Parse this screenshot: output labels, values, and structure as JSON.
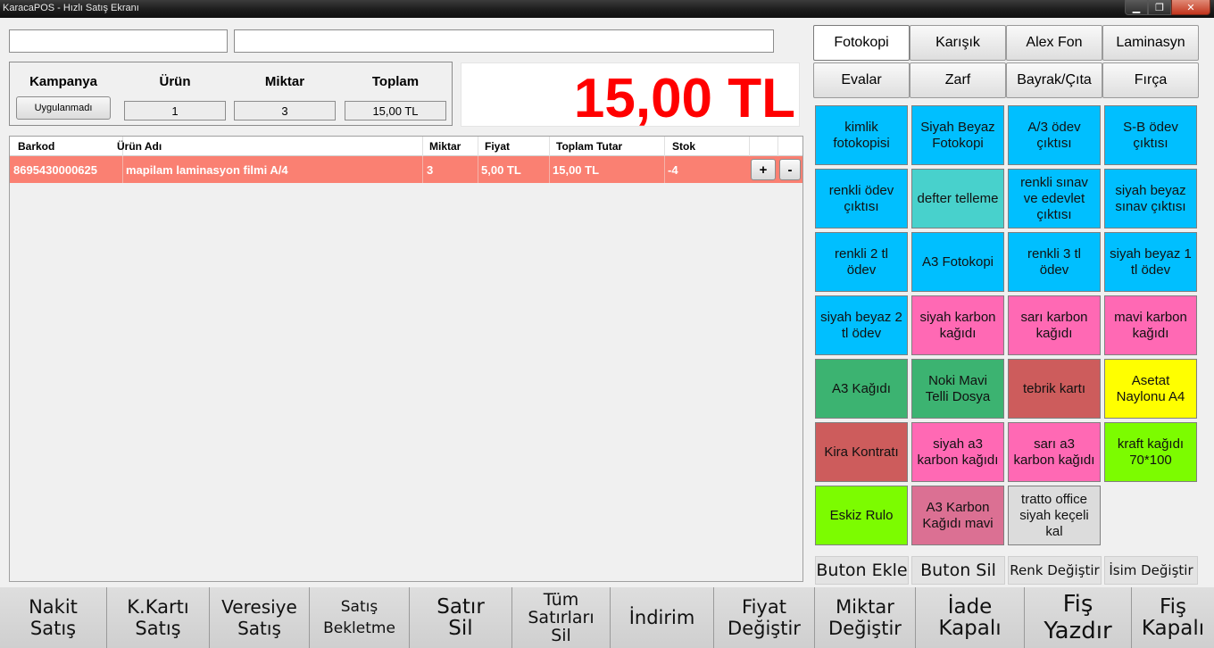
{
  "window": {
    "title": "KaracaPOS - Hızlı Satış Ekranı",
    "controls": {
      "minimize": "▁",
      "maximize": "❐",
      "close": "✕"
    }
  },
  "inputs": {
    "barcode_value": "",
    "search_value": ""
  },
  "info": {
    "kampanya_label": "Kampanya",
    "kampanya_button": "Uygulanmadı",
    "urun_label": "Ürün",
    "urun_value": "1",
    "miktar_label": "Miktar",
    "miktar_value": "3",
    "toplam_label": "Toplam",
    "toplam_value": "15,00 TL"
  },
  "total_display": "15,00 TL",
  "grid": {
    "headers": [
      "Barkod",
      "Ürün Adı",
      "Miktar",
      "Fiyat",
      "Toplam Tutar",
      "Stok"
    ],
    "rows": [
      {
        "barkod": "8695430000625",
        "urun_adi": "mapilam laminasyon filmi A/4",
        "miktar": "3",
        "fiyat": "5,00 TL",
        "toplam": "15,00 TL",
        "stok": "-4",
        "plus": "+",
        "minus": "-"
      }
    ],
    "row_color": "#fa8072"
  },
  "categories": [
    {
      "label": "Fotokopi",
      "active": true
    },
    {
      "label": "Karışık"
    },
    {
      "label": "Alex Fon"
    },
    {
      "label": "Laminasyn"
    },
    {
      "label": "Evalar"
    },
    {
      "label": "Zarf"
    },
    {
      "label": "Bayrak/Çıta"
    },
    {
      "label": "Fırça"
    }
  ],
  "products": [
    {
      "label": "kimlik fotokopisi",
      "color": "#00bfff"
    },
    {
      "label": "Siyah Beyaz Fotokopi",
      "color": "#00bfff"
    },
    {
      "label": "A/3 ödev çıktısı",
      "color": "#00bfff"
    },
    {
      "label": "S-B ödev çıktısı",
      "color": "#00bfff"
    },
    {
      "label": "renkli ödev çıktısı",
      "color": "#00bfff"
    },
    {
      "label": "defter telleme",
      "color": "#48d1cc"
    },
    {
      "label": "renkli sınav ve edevlet çıktısı",
      "color": "#00bfff"
    },
    {
      "label": "siyah beyaz sınav çıktısı",
      "color": "#00bfff"
    },
    {
      "label": "renkli 2 tl ödev",
      "color": "#00bfff"
    },
    {
      "label": "A3 Fotokopi",
      "color": "#00bfff"
    },
    {
      "label": "renkli 3 tl ödev",
      "color": "#00bfff"
    },
    {
      "label": "siyah beyaz 1 tl ödev",
      "color": "#00bfff"
    },
    {
      "label": "siyah beyaz 2 tl ödev",
      "color": "#00bfff"
    },
    {
      "label": "siyah karbon kağıdı",
      "color": "#ff69b4"
    },
    {
      "label": "sarı karbon kağıdı",
      "color": "#ff69b4"
    },
    {
      "label": "mavi karbon kağıdı",
      "color": "#ff69b4"
    },
    {
      "label": "A3 Kağıdı",
      "color": "#3cb371"
    },
    {
      "label": "Noki Mavi Telli Dosya",
      "color": "#3cb371"
    },
    {
      "label": "tebrik kartı",
      "color": "#cd5c5c"
    },
    {
      "label": "Asetat Naylonu A4",
      "color": "#ffff00"
    },
    {
      "label": "Kira Kontratı",
      "color": "#cd5c5c"
    },
    {
      "label": "siyah a3 karbon kağıdı",
      "color": "#ff69b4"
    },
    {
      "label": "sarı a3 karbon kağıdı",
      "color": "#ff69b4"
    },
    {
      "label": "kraft kağıdı 70*100",
      "color": "#7cfc00"
    },
    {
      "label": "Eskiz Rulo",
      "color": "#7cfc00"
    },
    {
      "label": "A3 Karbon Kağıdı mavi",
      "color": "#db7093"
    },
    {
      "label": "tratto office siyah keçeli kal",
      "color": "#dcdcdc"
    }
  ],
  "tools": {
    "buton_ekle": "Buton Ekle",
    "buton_sil": "Buton Sil",
    "renk_degistir": "Renk Değiştir",
    "isim_degistir": "İsim Değiştir"
  },
  "bottom": {
    "nakit": "Nakit Satış",
    "kkarti": "K.Kartı Satış",
    "veresiye": "Veresiye Satış",
    "bekletme": "Satış Bekletme",
    "satir_sil": "Satır Sil",
    "tum_sil": "Tüm Satırları Sil",
    "indirim": "İndirim",
    "fiyat_degistir": "Fiyat Değiştir",
    "miktar_degistir": "Miktar Değiştir",
    "iade": "İade Kapalı",
    "fis_yazdir": "Fiş Yazdır",
    "fis_kapali": "Fiş Kapalı"
  }
}
